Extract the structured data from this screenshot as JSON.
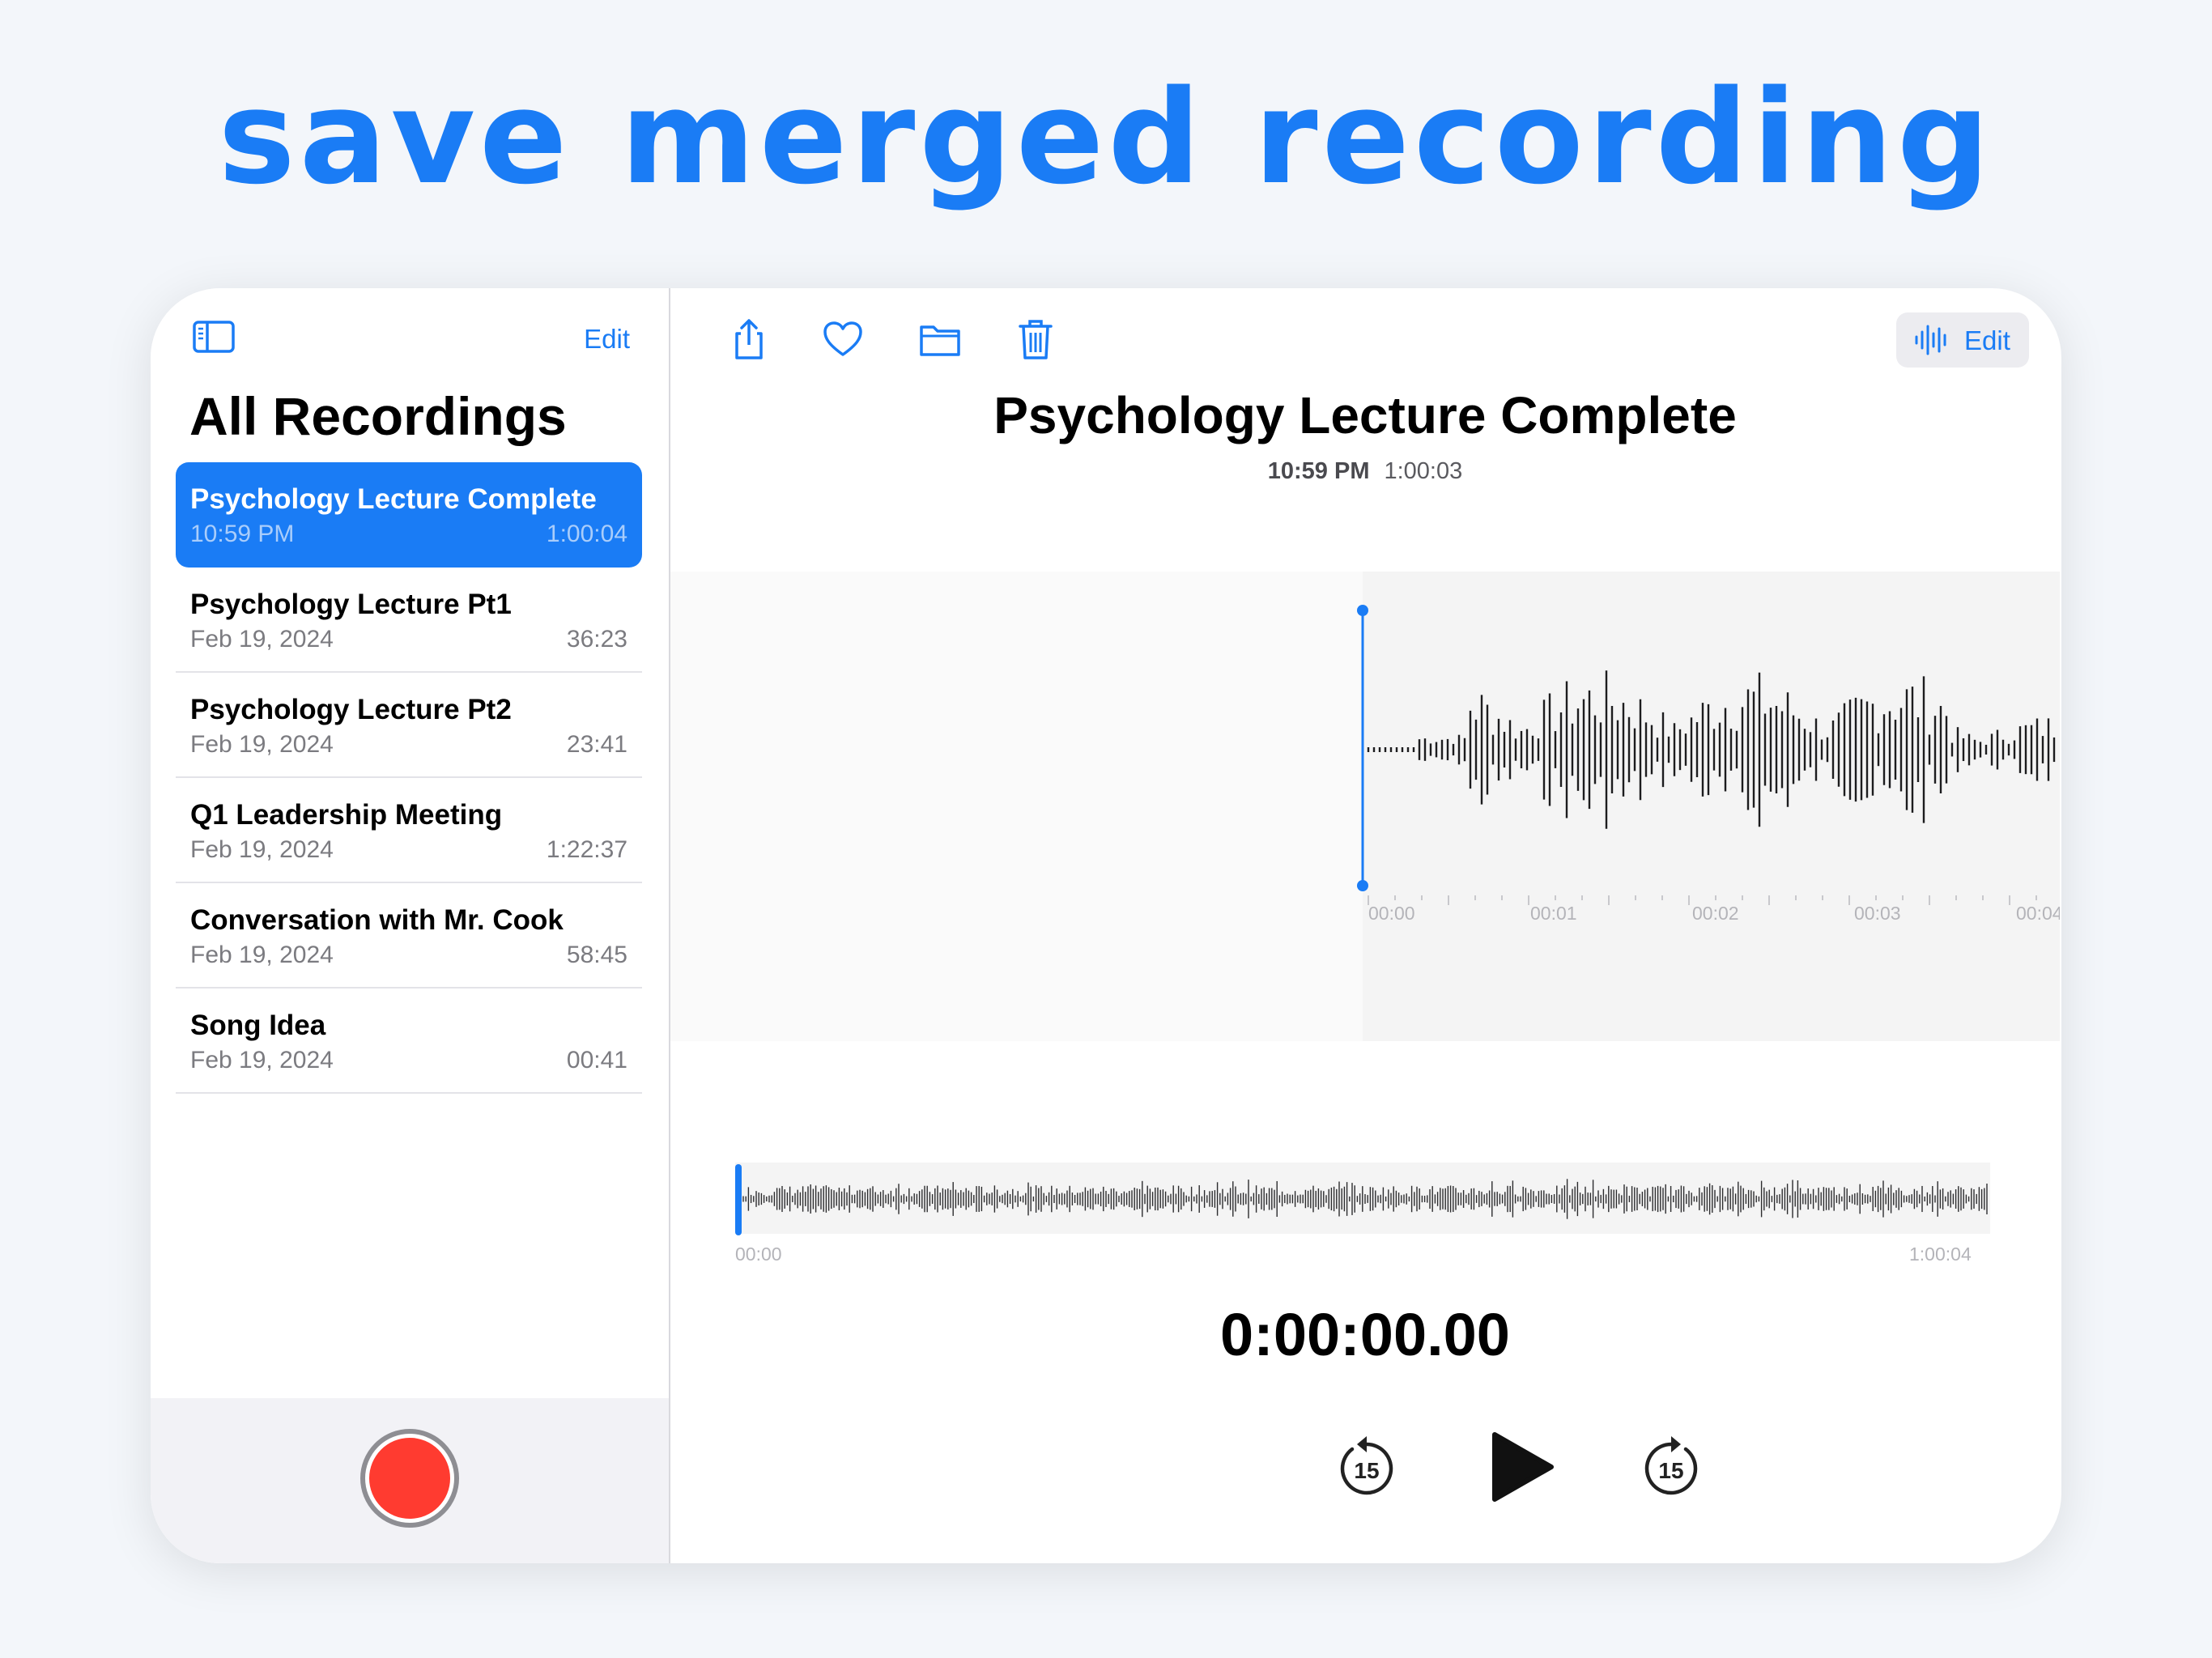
{
  "headline": "save merged recording",
  "sidebar": {
    "edit_label": "Edit",
    "title": "All Recordings",
    "recordings": [
      {
        "name": "Psychology Lecture Complete",
        "date": "10:59 PM",
        "duration": "1:00:04",
        "selected": true
      },
      {
        "name": "Psychology Lecture Pt1",
        "date": "Feb 19, 2024",
        "duration": "36:23"
      },
      {
        "name": "Psychology Lecture Pt2",
        "date": "Feb 19, 2024",
        "duration": "23:41"
      },
      {
        "name": "Q1 Leadership Meeting",
        "date": "Feb 19, 2024",
        "duration": "1:22:37"
      },
      {
        "name": "Conversation with Mr. Cook",
        "date": "Feb 19, 2024",
        "duration": "58:45"
      },
      {
        "name": "Song Idea",
        "date": "Feb 19, 2024",
        "duration": "00:41"
      }
    ]
  },
  "detail": {
    "edit_label": "Edit",
    "title": "Psychology Lecture Complete",
    "time": "10:59 PM",
    "length": "1:00:03",
    "timeline_ticks": [
      "00:00",
      "00:01",
      "00:02",
      "00:03",
      "00:04"
    ],
    "overview_start": "00:00",
    "overview_end": "1:00:04",
    "playhead_time": "0:00:00.00",
    "skip_back_label": "15",
    "skip_forward_label": "15"
  },
  "icons": {
    "toolbar": [
      "sidebar-toggle-icon",
      "share-icon",
      "heart-icon",
      "folder-icon",
      "trash-icon",
      "options-sliders-icon",
      "waveform-icon"
    ],
    "controls": [
      "skip-back-15-icon",
      "play-icon",
      "skip-forward-15-icon"
    ]
  },
  "colors": {
    "accent": "#1a7cf5",
    "record": "#ff3b30",
    "selected_row": "#1a7cf5"
  }
}
